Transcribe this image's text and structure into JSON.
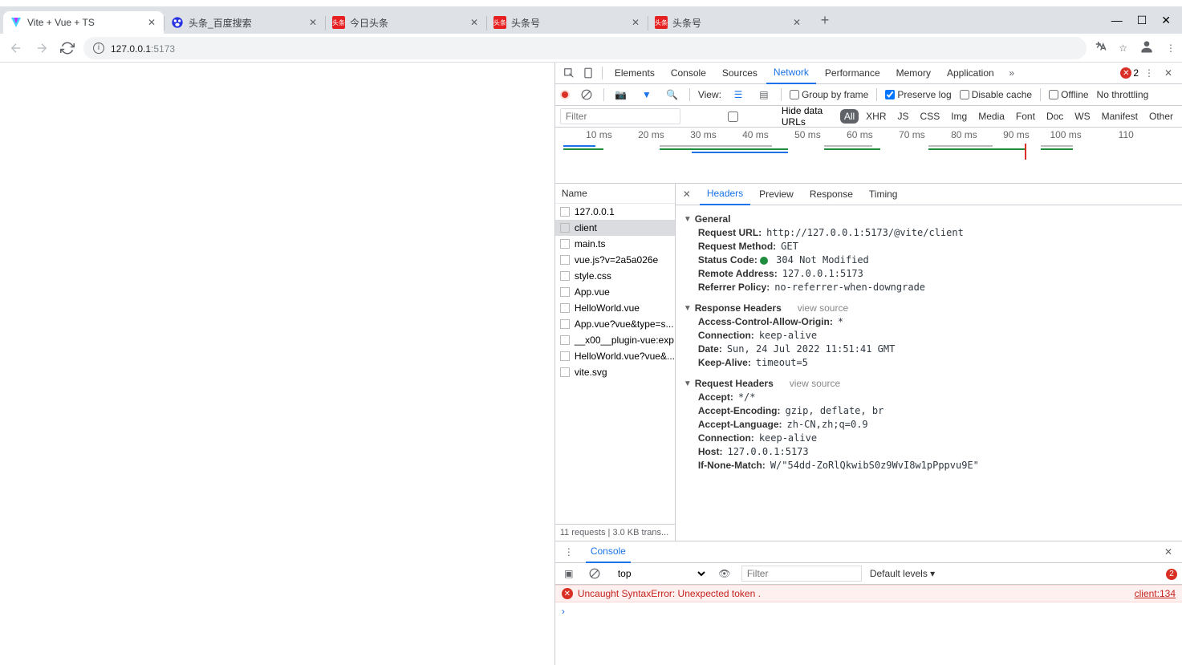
{
  "tabs": [
    {
      "title": "Vite + Vue + TS",
      "active": true,
      "icon": "vite"
    },
    {
      "title": "头条_百度搜索",
      "active": false,
      "icon": "baidu"
    },
    {
      "title": "今日头条",
      "active": false,
      "icon": "toutiao"
    },
    {
      "title": "头条号",
      "active": false,
      "icon": "toutiao"
    },
    {
      "title": "头条号",
      "active": false,
      "icon": "toutiao"
    }
  ],
  "url_host": "127.0.0.1",
  "url_port": ":5173",
  "devtools_tabs": [
    "Elements",
    "Console",
    "Sources",
    "Network",
    "Performance",
    "Memory",
    "Application"
  ],
  "devtools_active": "Network",
  "devtools_error_count": "2",
  "view_label": "View:",
  "group_by_frame": "Group by frame",
  "preserve_log": "Preserve log",
  "disable_cache": "Disable cache",
  "offline": "Offline",
  "no_throttling": "No throttling",
  "filter_placeholder": "Filter",
  "hide_data_urls": "Hide data URLs",
  "filter_types": [
    "All",
    "XHR",
    "JS",
    "CSS",
    "Img",
    "Media",
    "Font",
    "Doc",
    "WS",
    "Manifest",
    "Other"
  ],
  "filter_active": "All",
  "timeline": [
    "10 ms",
    "20 ms",
    "30 ms",
    "40 ms",
    "50 ms",
    "60 ms",
    "70 ms",
    "80 ms",
    "90 ms",
    "100 ms",
    "110"
  ],
  "reqlist_head": "Name",
  "requests": [
    "127.0.0.1",
    "client",
    "main.ts",
    "vue.js?v=2a5a026e",
    "style.css",
    "App.vue",
    "HelloWorld.vue",
    "App.vue?vue&type=s...",
    "__x00__plugin-vue:exp...",
    "HelloWorld.vue?vue&...",
    "vite.svg"
  ],
  "request_selected": "client",
  "reqlist_foot": "11 requests | 3.0 KB trans...",
  "rd_tabs": [
    "Headers",
    "Preview",
    "Response",
    "Timing"
  ],
  "rd_active": "Headers",
  "general_title": "General",
  "general": {
    "request_url_k": "Request URL:",
    "request_url_v": "http://127.0.0.1:5173/@vite/client",
    "request_method_k": "Request Method:",
    "request_method_v": "GET",
    "status_code_k": "Status Code:",
    "status_code_v": "304 Not Modified",
    "remote_addr_k": "Remote Address:",
    "remote_addr_v": "127.0.0.1:5173",
    "referrer_k": "Referrer Policy:",
    "referrer_v": "no-referrer-when-downgrade"
  },
  "resp_title": "Response Headers",
  "view_source": "view source",
  "resp": {
    "acao_k": "Access-Control-Allow-Origin:",
    "acao_v": "*",
    "conn_k": "Connection:",
    "conn_v": "keep-alive",
    "date_k": "Date:",
    "date_v": "Sun, 24 Jul 2022 11:51:41 GMT",
    "ka_k": "Keep-Alive:",
    "ka_v": "timeout=5"
  },
  "reqh_title": "Request Headers",
  "reqh": {
    "accept_k": "Accept:",
    "accept_v": "*/*",
    "ae_k": "Accept-Encoding:",
    "ae_v": "gzip, deflate, br",
    "al_k": "Accept-Language:",
    "al_v": "zh-CN,zh;q=0.9",
    "conn_k": "Connection:",
    "conn_v": "keep-alive",
    "host_k": "Host:",
    "host_v": "127.0.0.1:5173",
    "inm_k": "If-None-Match:",
    "inm_v": "W/\"54dd-ZoRlQkwibS0z9WvI8w1pPppvu9E\""
  },
  "console_label": "Console",
  "console_ctx": "top",
  "console_filter_placeholder": "Filter",
  "console_levels": "Default levels ▾",
  "console_err_count": "2",
  "console_err_msg": "Uncaught SyntaxError: Unexpected token .",
  "console_err_src": "client:134"
}
